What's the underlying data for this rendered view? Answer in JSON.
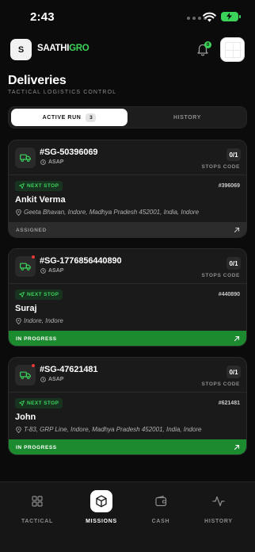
{
  "status_bar": {
    "time": "2:43"
  },
  "header": {
    "logo_letter": "S",
    "brand_part1": "SAATHI",
    "brand_part2": "GRO",
    "notification_count": "0"
  },
  "page": {
    "title": "Deliveries",
    "subtitle": "TACTICAL LOGISTICS CONTROL"
  },
  "segment": {
    "active_label": "ACTIVE RUN",
    "active_count": "3",
    "history_label": "HISTORY"
  },
  "cards": [
    {
      "id": "#SG-50396069",
      "priority": "ASAP",
      "stops": "0/1",
      "stops_label": "STOPS CODE",
      "next_stop_label": "NEXT STOP",
      "order_ref": "#396069",
      "customer": "Ankit Verma",
      "address": "Geeta Bhavan, Indore, Madhya Pradesh 452001, India, Indore",
      "status": "ASSIGNED"
    },
    {
      "id": "#SG-1776856440890",
      "priority": "ASAP",
      "stops": "0/1",
      "stops_label": "STOPS CODE",
      "next_stop_label": "NEXT STOP",
      "order_ref": "#440890",
      "customer": "Suraj",
      "address": "Indore, Indore",
      "status": "IN PROGRESS"
    },
    {
      "id": "#SG-47621481",
      "priority": "ASAP",
      "stops": "0/1",
      "stops_label": "STOPS CODE",
      "next_stop_label": "NEXT STOP",
      "order_ref": "#621481",
      "customer": "John",
      "address": "T-83, GRP Line, Indore, Madhya Pradesh 452001, India, Indore",
      "status": "IN PROGRESS"
    }
  ],
  "tabbar": {
    "tabs": [
      {
        "label": "TACTICAL",
        "icon": "grid-icon"
      },
      {
        "label": "MISSIONS",
        "icon": "package-icon"
      },
      {
        "label": "CASH",
        "icon": "wallet-icon"
      },
      {
        "label": "HISTORY",
        "icon": "activity-icon"
      }
    ]
  },
  "colors": {
    "accent": "#3bd35a",
    "in_progress": "#1c8a2e",
    "alert": "#e63838"
  }
}
